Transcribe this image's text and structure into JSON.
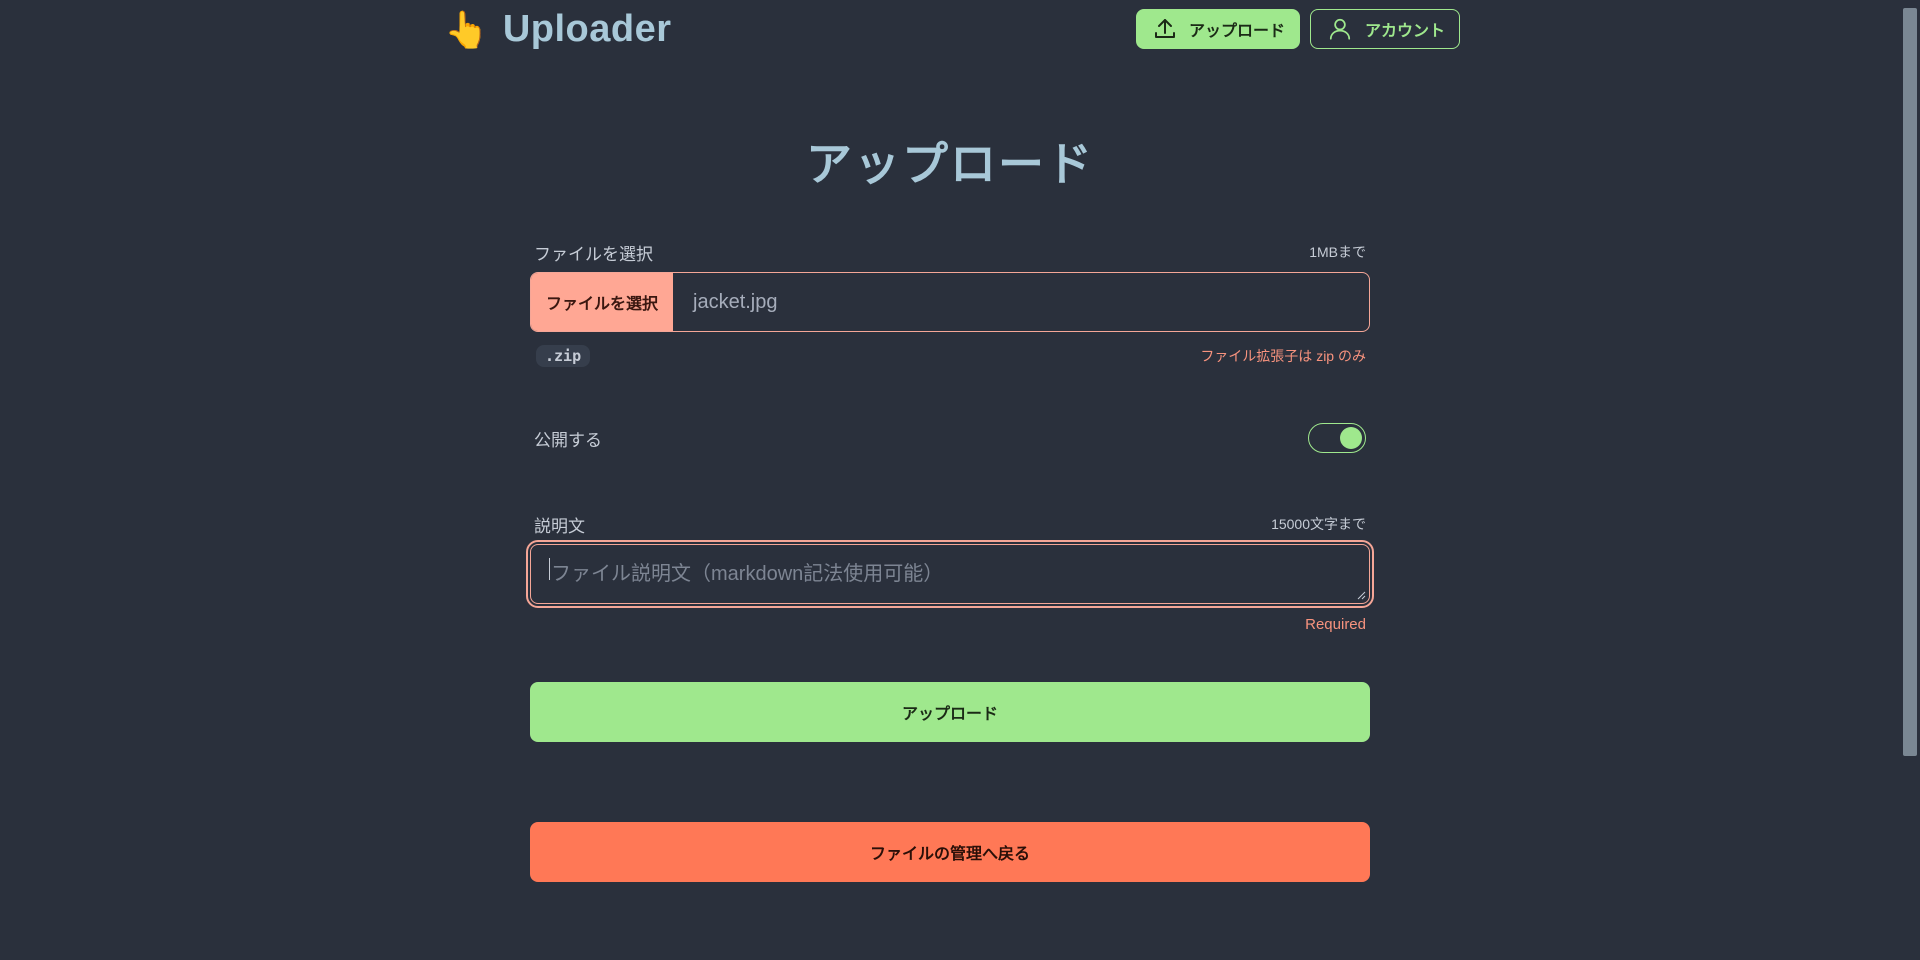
{
  "header": {
    "brand_emoji": "👆",
    "brand_name": "Uploader",
    "nav": {
      "upload_label": "アップロード",
      "account_label": "アカウント"
    }
  },
  "main": {
    "title": "アップロード",
    "file": {
      "label": "ファイルを選択",
      "limit": "1MBまで",
      "button_label": "ファイルを選択",
      "selected_file": "jacket.jpg",
      "ext_badge": ".zip",
      "error": "ファイル拡張子は zip のみ"
    },
    "public": {
      "label": "公開する",
      "enabled": true
    },
    "description": {
      "label": "説明文",
      "limit": "15000文字まで",
      "placeholder": "ファイル説明文（markdown記法使用可能）",
      "value": "",
      "error": "Required"
    },
    "submit_label": "アップロード",
    "back_label": "ファイルの管理へ戻る"
  },
  "colors": {
    "background": "#2a303c",
    "accent_green": "#9fe88d",
    "accent_salmon": "#ffa794",
    "danger": "#ff7856",
    "error_text": "#f8937e",
    "heading": "#a8c8d8"
  },
  "icons": {
    "upload": "upload-icon",
    "account": "user-icon"
  }
}
